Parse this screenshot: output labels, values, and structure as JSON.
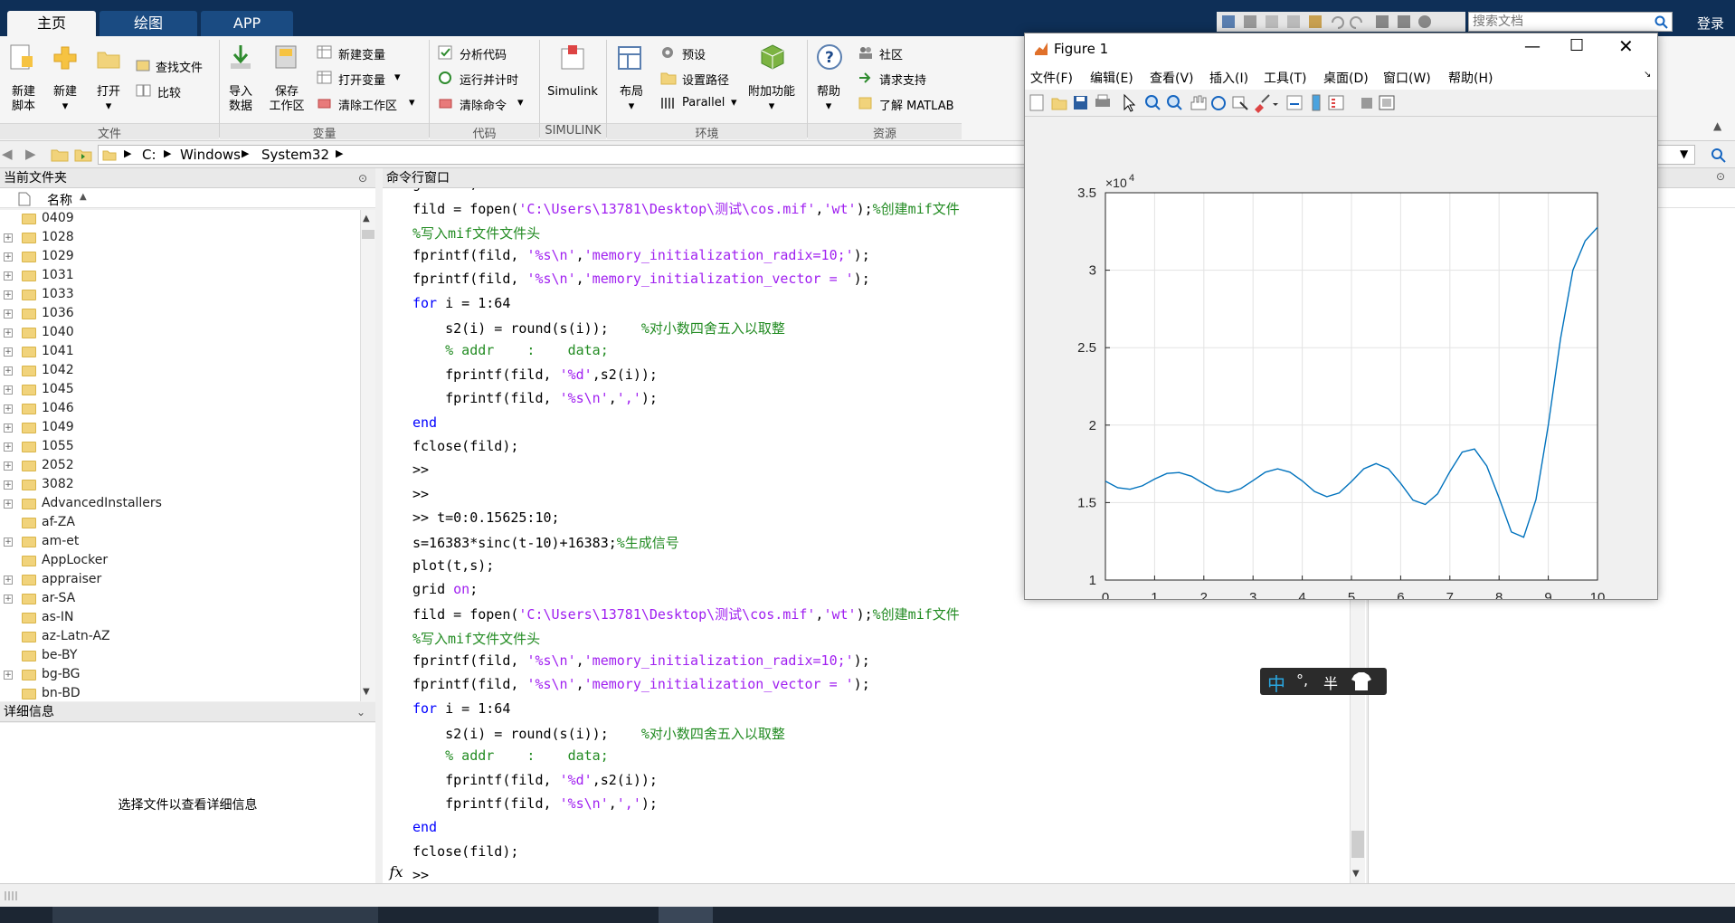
{
  "tabs": [
    "主页",
    "绘图",
    "APP"
  ],
  "search": {
    "placeholder": "搜索文档",
    "login": "登录"
  },
  "ribbon": {
    "new_script": "新建\n脚本",
    "new": "新建",
    "open": "打开",
    "find_files": "查找文件",
    "compare": "比较",
    "import": "导入\n数据",
    "save_ws": "保存\n工作区",
    "new_var": "新建变量",
    "open_var": "打开变量",
    "clear_ws": "清除工作区",
    "analyze": "分析代码",
    "run_time": "运行并计时",
    "clear_cmd": "清除命令",
    "simulink": "Simulink",
    "layout": "布局",
    "prefs": "预设",
    "set_path": "设置路径",
    "parallel": "Parallel",
    "addons": "附加功能",
    "help": "帮助",
    "community": "社区",
    "support": "请求支持",
    "learn": "了解 MATLAB",
    "sections": [
      "文件",
      "变量",
      "代码",
      "SIMULINK",
      "环境",
      "资源"
    ]
  },
  "address": [
    "C:",
    "Windows",
    "System32"
  ],
  "current_folder": {
    "title": "当前文件夹",
    "column": "名称",
    "items": [
      "0409",
      "1028",
      "1029",
      "1031",
      "1033",
      "1036",
      "1040",
      "1041",
      "1042",
      "1045",
      "1046",
      "1049",
      "1055",
      "2052",
      "3082",
      "AdvancedInstallers",
      "af-ZA",
      "am-et",
      "AppLocker",
      "appraiser",
      "ar-SA",
      "as-IN",
      "az-Latn-AZ",
      "be-BY",
      "bg-BG",
      "bn-BD"
    ],
    "expandable": [
      false,
      true,
      true,
      true,
      true,
      true,
      true,
      true,
      true,
      true,
      true,
      true,
      true,
      true,
      true,
      true,
      false,
      true,
      false,
      true,
      true,
      false,
      false,
      false,
      true,
      false
    ]
  },
  "details": {
    "title": "详细信息",
    "empty": "选择文件以查看详细信息"
  },
  "command_window": {
    "title": "命令行窗口",
    "fx": "fx",
    "lines": [
      [
        {
          "t": "grid ",
          "c": ""
        },
        {
          "t": "on",
          "c": "str"
        },
        {
          "t": ";",
          "c": ""
        }
      ],
      [
        {
          "t": "fild = fopen(",
          "c": ""
        },
        {
          "t": "'C:\\Users\\13781\\Desktop\\测试\\cos.mif'",
          "c": "str"
        },
        {
          "t": ",",
          "c": ""
        },
        {
          "t": "'wt'",
          "c": "str"
        },
        {
          "t": ");",
          "c": ""
        },
        {
          "t": "%创建mif文件",
          "c": "cmt"
        }
      ],
      [
        {
          "t": "%写入mif文件文件头",
          "c": "cmt"
        }
      ],
      [
        {
          "t": "fprintf(fild, ",
          "c": ""
        },
        {
          "t": "'%s\\n'",
          "c": "str"
        },
        {
          "t": ",",
          "c": ""
        },
        {
          "t": "'memory_initialization_radix=10;'",
          "c": "str"
        },
        {
          "t": ");",
          "c": ""
        }
      ],
      [
        {
          "t": "fprintf(fild, ",
          "c": ""
        },
        {
          "t": "'%s\\n'",
          "c": "str"
        },
        {
          "t": ",",
          "c": ""
        },
        {
          "t": "'memory_initialization_vector = '",
          "c": "str"
        },
        {
          "t": ");",
          "c": ""
        }
      ],
      [
        {
          "t": "for",
          "c": "kw"
        },
        {
          "t": " i = 1:64",
          "c": ""
        }
      ],
      [
        {
          "t": "    s2(i) = round(s(i));    ",
          "c": ""
        },
        {
          "t": "%对小数四舍五入以取整",
          "c": "cmt"
        }
      ],
      [
        {
          "t": "    % addr    :    data;",
          "c": "cmt"
        }
      ],
      [
        {
          "t": "    fprintf(fild, ",
          "c": ""
        },
        {
          "t": "'%d'",
          "c": "str"
        },
        {
          "t": ",s2(i));",
          "c": ""
        }
      ],
      [
        {
          "t": "    fprintf(fild, ",
          "c": ""
        },
        {
          "t": "'%s\\n'",
          "c": "str"
        },
        {
          "t": ",",
          "c": ""
        },
        {
          "t": "','",
          "c": "str"
        },
        {
          "t": ");",
          "c": ""
        }
      ],
      [
        {
          "t": "end",
          "c": "kw"
        }
      ],
      [
        {
          "t": "fclose(fild);",
          "c": ""
        }
      ],
      [
        {
          "t": ">>",
          "c": ""
        }
      ],
      [
        {
          "t": ">>",
          "c": ""
        }
      ],
      [
        {
          "t": ">> t=0:0.15625:10;",
          "c": ""
        }
      ],
      [
        {
          "t": "s=16383*sinc(t-10)+16383;",
          "c": ""
        },
        {
          "t": "%生成信号",
          "c": "cmt"
        }
      ],
      [
        {
          "t": "plot(t,s);",
          "c": ""
        }
      ],
      [
        {
          "t": "grid ",
          "c": ""
        },
        {
          "t": "on",
          "c": "str"
        },
        {
          "t": ";",
          "c": ""
        }
      ],
      [
        {
          "t": "fild = fopen(",
          "c": ""
        },
        {
          "t": "'C:\\Users\\13781\\Desktop\\测试\\cos.mif'",
          "c": "str"
        },
        {
          "t": ",",
          "c": ""
        },
        {
          "t": "'wt'",
          "c": "str"
        },
        {
          "t": ");",
          "c": ""
        },
        {
          "t": "%创建mif文件",
          "c": "cmt"
        }
      ],
      [
        {
          "t": "%写入mif文件文件头",
          "c": "cmt"
        }
      ],
      [
        {
          "t": "fprintf(fild, ",
          "c": ""
        },
        {
          "t": "'%s\\n'",
          "c": "str"
        },
        {
          "t": ",",
          "c": ""
        },
        {
          "t": "'memory_initialization_radix=10;'",
          "c": "str"
        },
        {
          "t": ");",
          "c": ""
        }
      ],
      [
        {
          "t": "fprintf(fild, ",
          "c": ""
        },
        {
          "t": "'%s\\n'",
          "c": "str"
        },
        {
          "t": ",",
          "c": ""
        },
        {
          "t": "'memory_initialization_vector = '",
          "c": "str"
        },
        {
          "t": ");",
          "c": ""
        }
      ],
      [
        {
          "t": "for",
          "c": "kw"
        },
        {
          "t": " i = 1:64",
          "c": ""
        }
      ],
      [
        {
          "t": "    s2(i) = round(s(i));    ",
          "c": ""
        },
        {
          "t": "%对小数四舍五入以取整",
          "c": "cmt"
        }
      ],
      [
        {
          "t": "    % addr    :    data;",
          "c": "cmt"
        }
      ],
      [
        {
          "t": "    fprintf(fild, ",
          "c": ""
        },
        {
          "t": "'%d'",
          "c": "str"
        },
        {
          "t": ",s2(i));",
          "c": ""
        }
      ],
      [
        {
          "t": "    fprintf(fild, ",
          "c": ""
        },
        {
          "t": "'%s\\n'",
          "c": "str"
        },
        {
          "t": ",",
          "c": ""
        },
        {
          "t": "','",
          "c": "str"
        },
        {
          "t": ");",
          "c": ""
        }
      ],
      [
        {
          "t": "end",
          "c": "kw"
        }
      ],
      [
        {
          "t": "fclose(fild);",
          "c": ""
        }
      ]
    ],
    "prompt": ">>"
  },
  "figure": {
    "title": "Figure 1",
    "menu": [
      "文件(F)",
      "编辑(E)",
      "查看(V)",
      "插入(I)",
      "工具(T)",
      "桌面(D)",
      "窗口(W)",
      "帮助(H)"
    ]
  },
  "ime": {
    "lang": "中",
    "punct": "°,",
    "half": "半"
  },
  "chart_data": {
    "type": "line",
    "title": "",
    "xlabel": "",
    "ylabel": "",
    "exponent_label": "×10",
    "exponent": "4",
    "xlim": [
      0,
      10
    ],
    "ylim": [
      1,
      3.5
    ],
    "xticks": [
      0,
      1,
      2,
      3,
      4,
      5,
      6,
      7,
      8,
      9,
      10
    ],
    "yticks": [
      1,
      1.5,
      2,
      2.5,
      3,
      3.5
    ],
    "ytick_labels": [
      "1",
      "1.5",
      "2",
      "2.5",
      "3",
      "3.5"
    ],
    "grid": true,
    "color": "#0072bd",
    "series": [
      {
        "x": [
          0,
          0.25,
          0.5,
          0.75,
          1,
          1.25,
          1.5,
          1.75,
          2,
          2.25,
          2.5,
          2.75,
          3,
          3.25,
          3.5,
          3.75,
          4,
          4.25,
          4.5,
          4.75,
          5,
          5.25,
          5.5,
          5.75,
          6,
          6.25,
          6.5,
          6.75,
          7,
          7.25,
          7.5,
          7.75,
          8,
          8.25,
          8.5,
          8.75,
          9,
          9.25,
          9.5,
          9.75,
          10
        ],
        "y": [
          1.638,
          1.596,
          1.586,
          1.608,
          1.652,
          1.688,
          1.694,
          1.67,
          1.622,
          1.578,
          1.566,
          1.59,
          1.642,
          1.696,
          1.718,
          1.696,
          1.64,
          1.572,
          1.538,
          1.562,
          1.636,
          1.718,
          1.752,
          1.718,
          1.624,
          1.516,
          1.488,
          1.556,
          1.7,
          1.826,
          1.846,
          1.736,
          1.53,
          1.31,
          1.276,
          1.52,
          2.0,
          2.56,
          3.0,
          3.19,
          3.277
        ]
      }
    ]
  }
}
